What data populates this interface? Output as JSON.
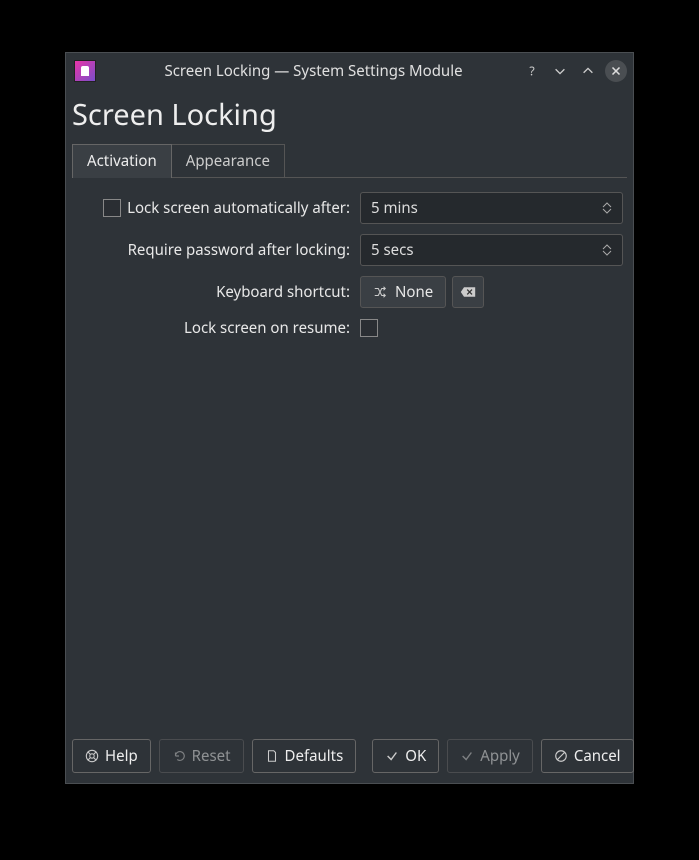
{
  "titlebar": {
    "title": "Screen Locking — System Settings Module"
  },
  "page": {
    "title": "Screen Locking"
  },
  "tabs": {
    "activation": "Activation",
    "appearance": "Appearance"
  },
  "form": {
    "lock_auto_label": "Lock screen automatically after:",
    "lock_auto_value": "5 mins",
    "require_password_label": "Require password after locking:",
    "require_password_value": "5 secs",
    "keyboard_shortcut_label": "Keyboard shortcut:",
    "keyboard_shortcut_value": "None",
    "lock_on_resume_label": "Lock screen on resume:"
  },
  "buttons": {
    "help": "Help",
    "reset": "Reset",
    "defaults": "Defaults",
    "ok": "OK",
    "apply": "Apply",
    "cancel": "Cancel"
  }
}
